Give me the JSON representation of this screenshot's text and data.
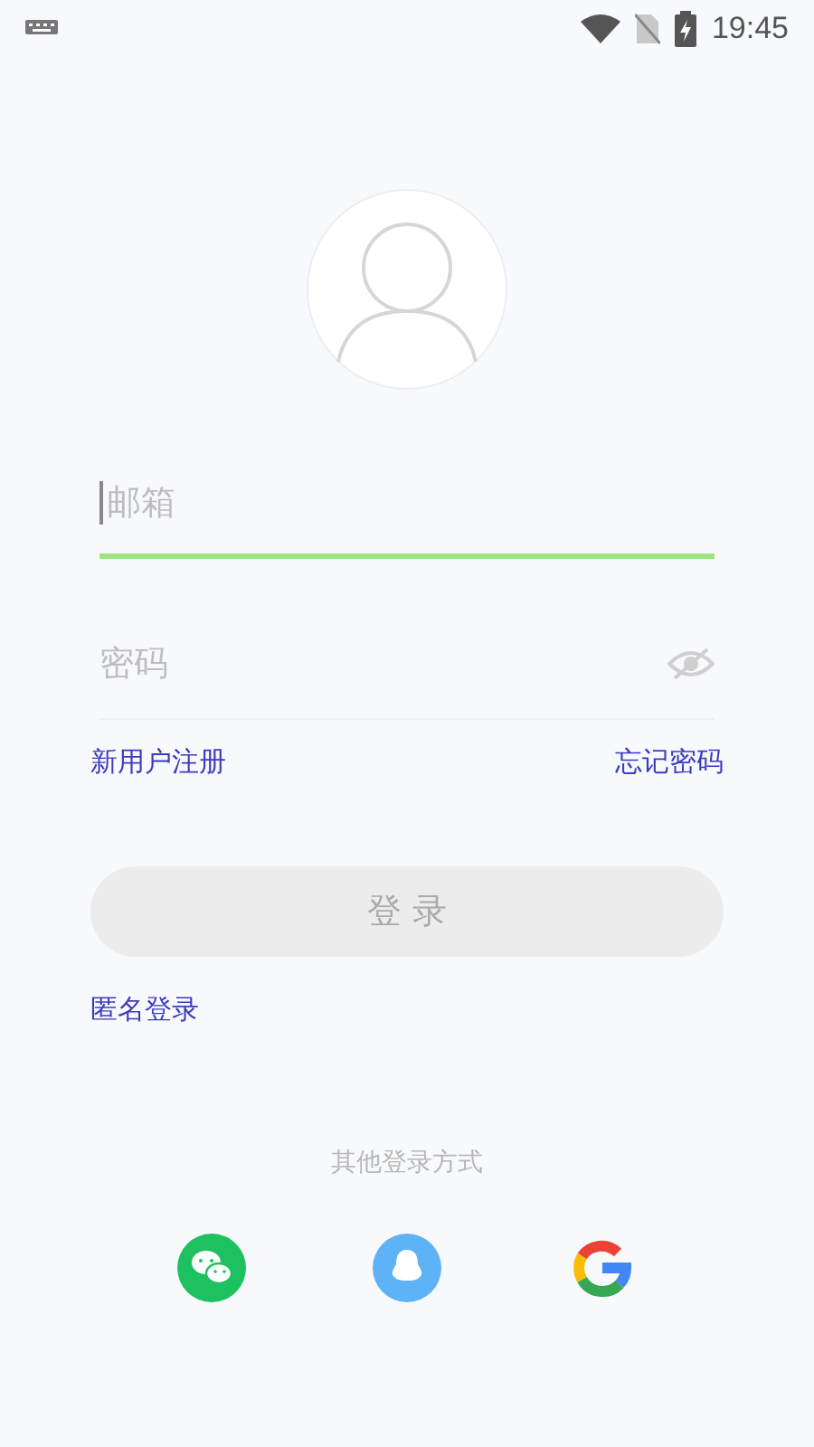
{
  "status_bar": {
    "time": "19:45"
  },
  "fields": [
    {
      "kind": "email",
      "placeholder": "邮箱",
      "focused": true
    },
    {
      "kind": "password",
      "placeholder": "密码",
      "focused": false,
      "visible": false
    }
  ],
  "links": {
    "register": "新用户注册",
    "forgot": "忘记密码"
  },
  "login_button": {
    "label": "登 录",
    "disabled": true
  },
  "anonymous_login": "匿名登录",
  "other_login": {
    "label": "其他登录方式",
    "providers": [
      {
        "kind": "wechat"
      },
      {
        "kind": "qq"
      },
      {
        "kind": "google"
      }
    ]
  }
}
